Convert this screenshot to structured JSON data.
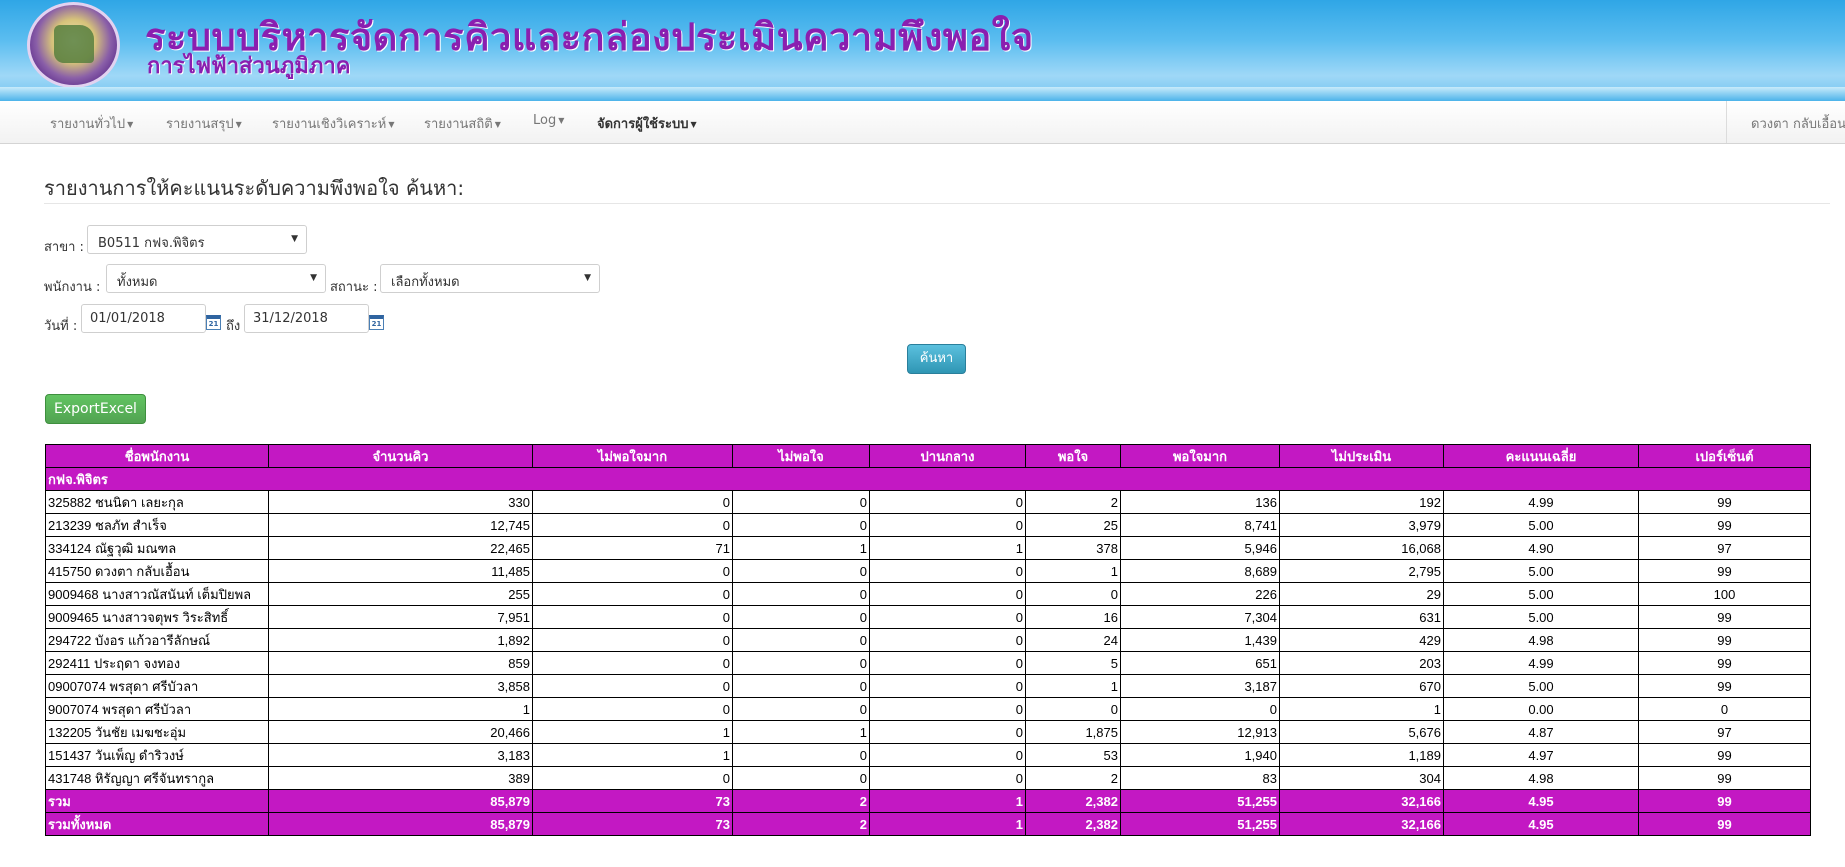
{
  "header": {
    "title": "ระบบบริหารจัดการคิวและกล่องประเมินความพึงพอใจ",
    "subtitle": "การไฟฟ้าส่วนภูมิภาค"
  },
  "nav": {
    "items": [
      {
        "label": "รายงานทั่วไป"
      },
      {
        "label": "รายงานสรุป"
      },
      {
        "label": "รายงานเชิงวิเคราะห์"
      },
      {
        "label": "รายงานสถิติ"
      },
      {
        "label": "Log"
      },
      {
        "label": "จัดการผู้ใช้ระบบ"
      }
    ],
    "user": "ดวงตา กลับเอื้อน"
  },
  "page": {
    "title": "รายงานการให้คะแนนระดับความพึงพอใจ ค้นหา:"
  },
  "form": {
    "branch_label": "สาขา :",
    "branch_value": "B0511 กฟจ.พิจิตร",
    "employee_label": "พนักงาน :",
    "employee_value": "ทั้งหมด",
    "status_label": "สถานะ :",
    "status_value": "เลือกทั้งหมด",
    "date_label": "วันที่ :",
    "date_from": "01/01/2018",
    "to_label": "ถึง",
    "date_to": "31/12/2018",
    "calendar_text": "21",
    "search_button": "ค้นหา",
    "export_button": "ExportExcel"
  },
  "table": {
    "headers": [
      "ชื่อพนักงาน",
      "จำนวนคิว",
      "ไม่พอใจมาก",
      "ไม่พอใจ",
      "ปานกลาง",
      "พอใจ",
      "พอใจมาก",
      "ไม่ประเมิน",
      "คะแนนเฉลี่ย",
      "เปอร์เซ็นต์"
    ],
    "group": "กฟจ.พิจิตร",
    "rows": [
      [
        "325882 ชนนิดา เลยะกุล",
        "330",
        "0",
        "0",
        "0",
        "2",
        "136",
        "192",
        "4.99",
        "99"
      ],
      [
        "213239 ชลภัท สำเร็จ",
        "12,745",
        "0",
        "0",
        "0",
        "25",
        "8,741",
        "3,979",
        "5.00",
        "99"
      ],
      [
        "334124 ณัฐวุฒิ มณฑล",
        "22,465",
        "71",
        "1",
        "1",
        "378",
        "5,946",
        "16,068",
        "4.90",
        "97"
      ],
      [
        "415750 ดวงตา กลับเอื้อน",
        "11,485",
        "0",
        "0",
        "0",
        "1",
        "8,689",
        "2,795",
        "5.00",
        "99"
      ],
      [
        "9009468 นางสาวณัสนันท์ เต็มปิยพล",
        "255",
        "0",
        "0",
        "0",
        "0",
        "226",
        "29",
        "5.00",
        "100"
      ],
      [
        "9009465 นางสาวจตุพร วิระสิทธิ์",
        "7,951",
        "0",
        "0",
        "0",
        "16",
        "7,304",
        "631",
        "5.00",
        "99"
      ],
      [
        "294722 บังอร แก้วอารีลักษณ์",
        "1,892",
        "0",
        "0",
        "0",
        "24",
        "1,439",
        "429",
        "4.98",
        "99"
      ],
      [
        "292411 ประฤดา จงทอง",
        "859",
        "0",
        "0",
        "0",
        "5",
        "651",
        "203",
        "4.99",
        "99"
      ],
      [
        "09007074 พรสุดา ศรีบัวลา",
        "3,858",
        "0",
        "0",
        "0",
        "1",
        "3,187",
        "670",
        "5.00",
        "99"
      ],
      [
        "9007074 พรสุดา ศรีบัวลา",
        "1",
        "0",
        "0",
        "0",
        "0",
        "0",
        "1",
        "0.00",
        "0"
      ],
      [
        "132205 วันชัย เมฆชะอุ่ม",
        "20,466",
        "1",
        "1",
        "0",
        "1,875",
        "12,913",
        "5,676",
        "4.87",
        "97"
      ],
      [
        "151437 วันเพ็ญ ดำริวงษ์",
        "3,183",
        "1",
        "0",
        "0",
        "53",
        "1,940",
        "1,189",
        "4.97",
        "99"
      ],
      [
        "431748 หิรัญญา ศรีจันทรากูล",
        "389",
        "0",
        "0",
        "0",
        "2",
        "83",
        "304",
        "4.98",
        "99"
      ]
    ],
    "subtotal": [
      "รวม",
      "85,879",
      "73",
      "2",
      "1",
      "2,382",
      "51,255",
      "32,166",
      "4.95",
      "99"
    ],
    "total": [
      "รวมทั้งหมด",
      "85,879",
      "73",
      "2",
      "1",
      "2,382",
      "51,255",
      "32,166",
      "4.95",
      "99"
    ]
  },
  "colors": {
    "table_header": "#c318c3",
    "banner_title": "#8a1fb0",
    "search_button": "#2f96b4",
    "export_button": "#51a351"
  }
}
